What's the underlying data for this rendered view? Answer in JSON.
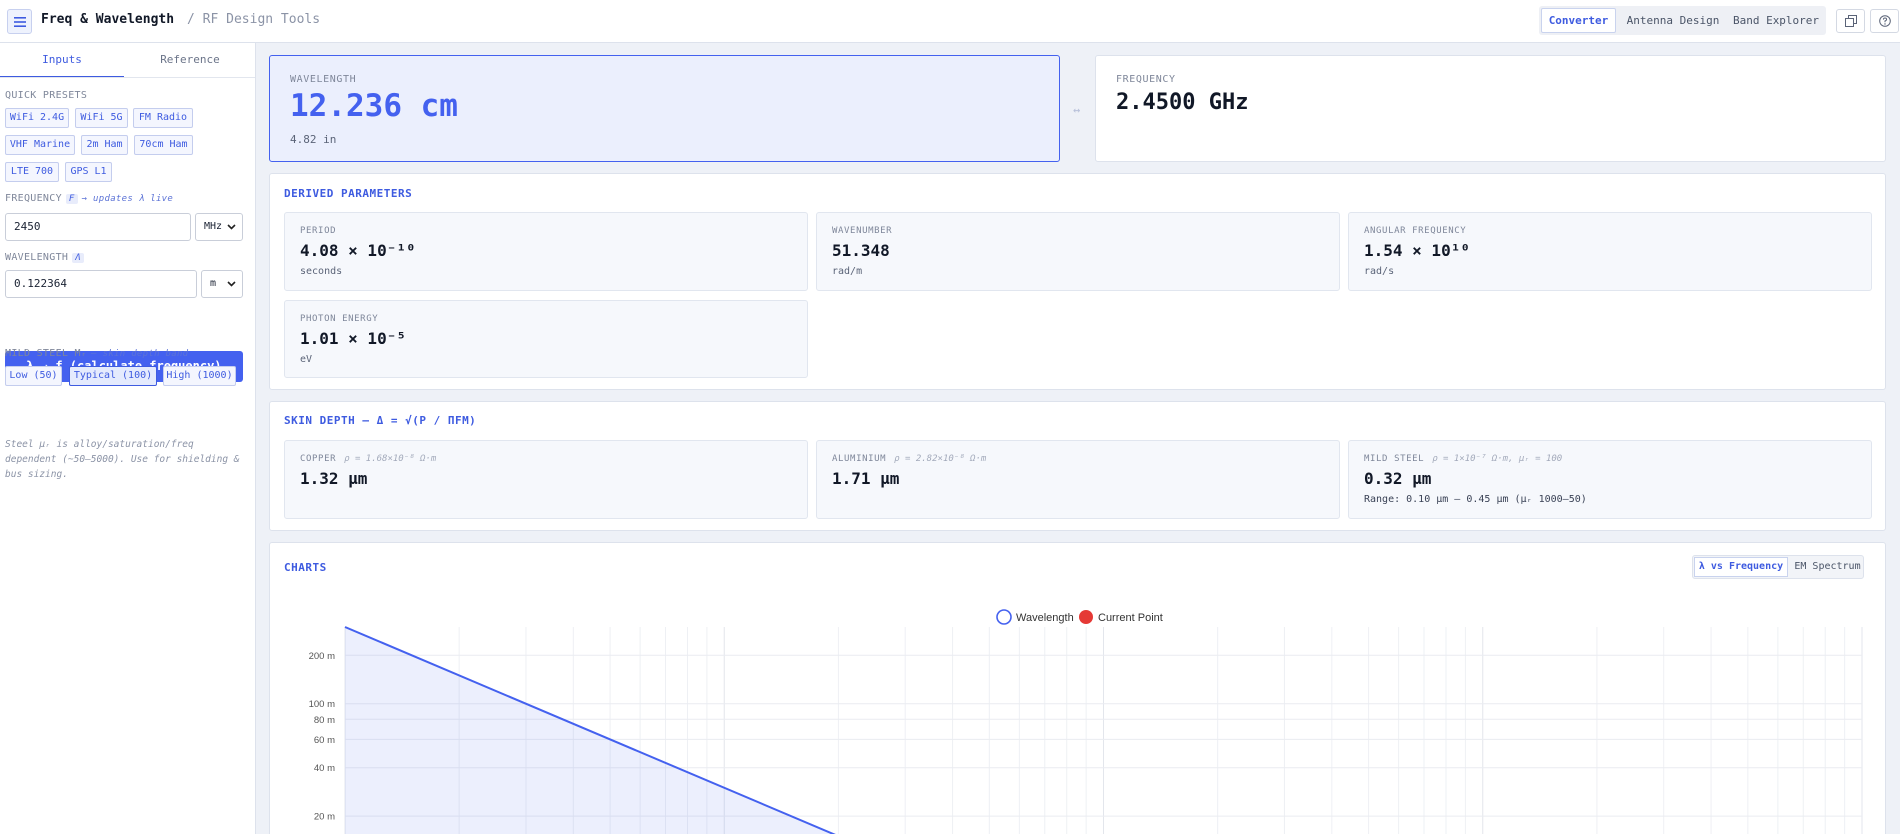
{
  "header": {
    "title": "Freq & Wavelength",
    "subtitle": "/ RF Design Tools",
    "tabs": [
      "Converter",
      "Antenna Design",
      "Band Explorer"
    ],
    "active_tab": "Converter"
  },
  "sidebar": {
    "tabs": [
      "Inputs",
      "Reference"
    ],
    "presets_label": "QUICK PRESETS",
    "presets": [
      "WiFi 2.4G",
      "WiFi 5G",
      "FM Radio",
      "VHF Marine",
      "2m Ham",
      "70cm Ham",
      "LTE 700",
      "GPS L1"
    ],
    "frequency_label": "FREQUENCY",
    "frequency_tag": "F",
    "frequency_hint": "→ updates λ live",
    "frequency_value": "2450",
    "frequency_unit": "MHz",
    "wavelength_label": "WAVELENGTH",
    "wavelength_tag": "Λ",
    "wavelength_value": "0.122364",
    "wavelength_unit": "m",
    "calc_button": "λ → f (calculate frequency)",
    "steel_label": "MILD STEEL Mᵣ",
    "steel_hint": "— skin depth band",
    "steel_options": [
      "Low (50)",
      "Typical (100)",
      "High (1000)"
    ],
    "steel_selected": "Typical (100)",
    "steel_note": "Steel μᵣ is alloy/saturation/freq dependent (~50–5000). Use for shielding & bus sizing."
  },
  "wavelength_card": {
    "label": "WAVELENGTH",
    "value": "12.236 cm",
    "secondary": "4.82 in"
  },
  "swap_icon": "↔",
  "frequency_card": {
    "label": "FREQUENCY",
    "value": "2.4500 GHz"
  },
  "derived": {
    "title": "DERIVED PARAMETERS",
    "params": [
      {
        "label": "PERIOD",
        "value": "4.08 × 10⁻¹⁰",
        "unit": "seconds"
      },
      {
        "label": "WAVENUMBER",
        "value": "51.348",
        "unit": "rad/m"
      },
      {
        "label": "ANGULAR FREQUENCY",
        "value": "1.54 × 10¹⁰",
        "unit": "rad/s"
      },
      {
        "label": "PHOTON ENERGY",
        "value": "1.01 × 10⁻⁵",
        "unit": "eV"
      }
    ]
  },
  "skin": {
    "title": "SKIN DEPTH — Δ = √(Ρ / ΠFΜ)",
    "materials": [
      {
        "label": "COPPER",
        "rho": "ρ = 1.68×10⁻⁸ Ω·m",
        "value": "1.32 µm",
        "range": ""
      },
      {
        "label": "ALUMINIUM",
        "rho": "ρ = 2.82×10⁻⁸ Ω·m",
        "value": "1.71 µm",
        "range": ""
      },
      {
        "label": "MILD STEEL",
        "rho": "ρ = 1×10⁻⁷ Ω·m, μᵣ = 100",
        "value": "0.32 µm",
        "range": "Range: 0.10 µm – 0.45 µm (μᵣ 1000–50)"
      }
    ]
  },
  "charts": {
    "title": "CHARTS",
    "tabs": [
      "λ vs Frequency",
      "EM Spectrum"
    ],
    "active_tab": "λ vs Frequency"
  },
  "colors": {
    "accent": "#4461ef",
    "current_point": "#e53935"
  },
  "chart_data": {
    "type": "area",
    "title": "",
    "legend": [
      "Wavelength",
      "Current Point"
    ],
    "legend_position": "top-center",
    "y_scale": "log",
    "y_ticks": [
      "200 m",
      "100 m",
      "80 m",
      "60 m",
      "40 m",
      "20 m"
    ],
    "y_tick_values": [
      200,
      100,
      80,
      60,
      40,
      20
    ],
    "x_scale": "log",
    "x_unit": "Hz",
    "xlim": [
      1000000,
      10000000000
    ],
    "ylim": [
      14,
      300
    ],
    "series": [
      {
        "name": "Wavelength",
        "x": [
          1000000,
          20000000
        ],
        "y": [
          300,
          15
        ]
      }
    ],
    "grid": true
  }
}
